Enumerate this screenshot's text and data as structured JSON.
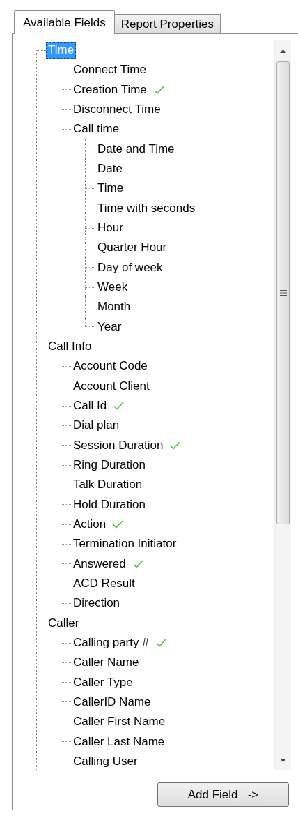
{
  "tabs": [
    {
      "label": "Available Fields",
      "selected": true
    },
    {
      "label": "Report Properties",
      "selected": false
    }
  ],
  "tree": [
    {
      "label": "Time",
      "selected": true,
      "checked": false,
      "children": [
        {
          "label": "Connect Time",
          "selected": false,
          "checked": false
        },
        {
          "label": "Creation Time",
          "selected": false,
          "checked": true
        },
        {
          "label": "Disconnect Time",
          "selected": false,
          "checked": false
        },
        {
          "label": "Call time",
          "selected": false,
          "checked": false,
          "children": [
            {
              "label": "Date and Time",
              "selected": false,
              "checked": false
            },
            {
              "label": "Date",
              "selected": false,
              "checked": false
            },
            {
              "label": "Time",
              "selected": false,
              "checked": false
            },
            {
              "label": "Time with seconds",
              "selected": false,
              "checked": false
            },
            {
              "label": "Hour",
              "selected": false,
              "checked": false
            },
            {
              "label": "Quarter Hour",
              "selected": false,
              "checked": false
            },
            {
              "label": "Day of week",
              "selected": false,
              "checked": false
            },
            {
              "label": "Week",
              "selected": false,
              "checked": false
            },
            {
              "label": "Month",
              "selected": false,
              "checked": false
            },
            {
              "label": "Year",
              "selected": false,
              "checked": false
            }
          ]
        }
      ]
    },
    {
      "label": "Call Info",
      "selected": false,
      "checked": false,
      "children": [
        {
          "label": "Account Code",
          "selected": false,
          "checked": false
        },
        {
          "label": "Account Client",
          "selected": false,
          "checked": false
        },
        {
          "label": "Call Id",
          "selected": false,
          "checked": true
        },
        {
          "label": "Dial plan",
          "selected": false,
          "checked": false
        },
        {
          "label": "Session Duration",
          "selected": false,
          "checked": true
        },
        {
          "label": "Ring Duration",
          "selected": false,
          "checked": false
        },
        {
          "label": "Talk Duration",
          "selected": false,
          "checked": false
        },
        {
          "label": "Hold Duration",
          "selected": false,
          "checked": false
        },
        {
          "label": "Action",
          "selected": false,
          "checked": true
        },
        {
          "label": "Termination Initiator",
          "selected": false,
          "checked": false
        },
        {
          "label": "Answered",
          "selected": false,
          "checked": true
        },
        {
          "label": "ACD Result",
          "selected": false,
          "checked": false
        },
        {
          "label": "Direction",
          "selected": false,
          "checked": false
        }
      ]
    },
    {
      "label": "Caller",
      "selected": false,
      "checked": false,
      "children": [
        {
          "label": "Calling party #",
          "selected": false,
          "checked": true
        },
        {
          "label": "Caller Name",
          "selected": false,
          "checked": false
        },
        {
          "label": "Caller Type",
          "selected": false,
          "checked": false
        },
        {
          "label": "CallerID Name",
          "selected": false,
          "checked": false
        },
        {
          "label": "Caller First Name",
          "selected": false,
          "checked": false
        },
        {
          "label": "Caller Last Name",
          "selected": false,
          "checked": false
        },
        {
          "label": "Calling User",
          "selected": false,
          "checked": false
        }
      ]
    }
  ],
  "add_button": "Add Field   ->"
}
